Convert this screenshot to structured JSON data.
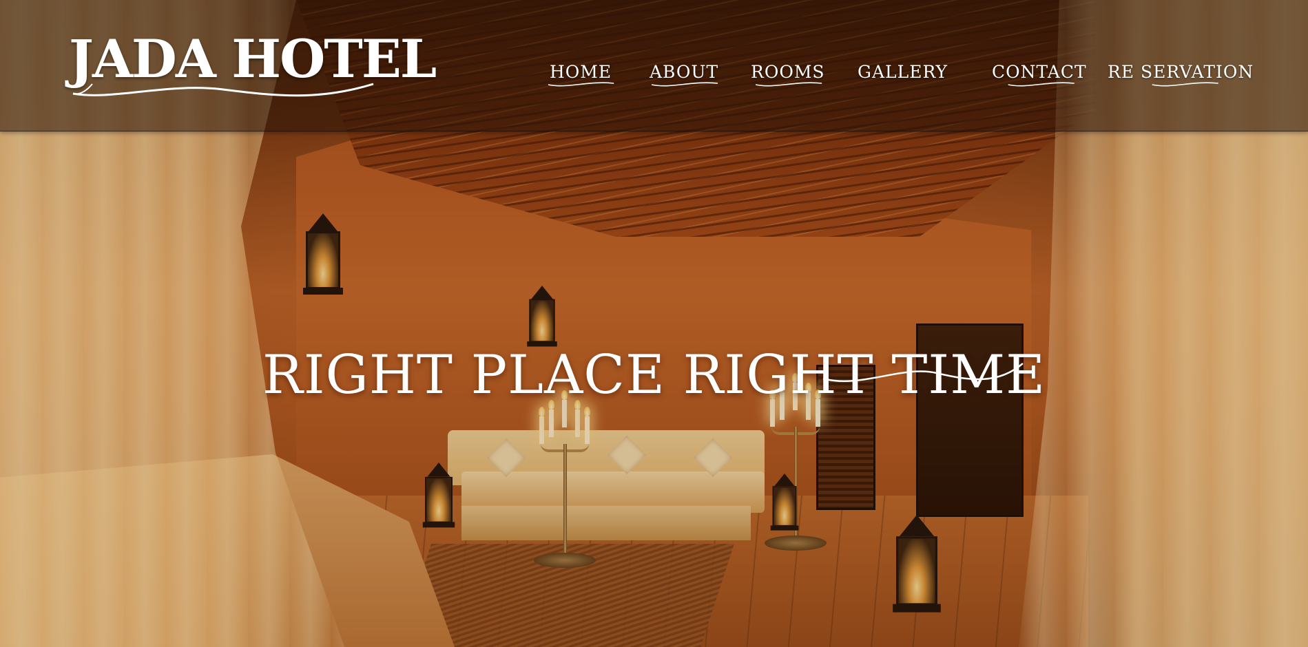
{
  "logo": {
    "text": "JADA HOTEL"
  },
  "nav": {
    "items": [
      {
        "label": "HOME"
      },
      {
        "label": "ABOUT"
      },
      {
        "label": "ROOMS"
      },
      {
        "label": "GALLERY"
      },
      {
        "label": "CONTACT"
      },
      {
        "label": "RE SERVATION"
      }
    ]
  },
  "hero": {
    "headline": "RIGHT PLACE RIGHT TIME"
  },
  "colors": {
    "text": "#ffffff",
    "navbar_overlay": "rgba(40,18,6,0.55)",
    "accent_warm": "#c96a2c"
  },
  "icons": [
    "decorative-swash"
  ]
}
